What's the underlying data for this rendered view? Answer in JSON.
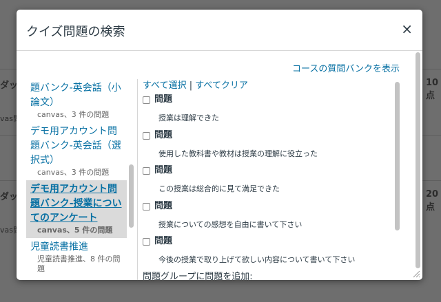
{
  "background": {
    "rows": [
      {
        "left_text": "ダッ",
        "right_text": "10 点"
      },
      {
        "left_text": "vas問",
        "right_text": ""
      },
      {
        "left_text": "ダッ",
        "right_text": "20 点"
      },
      {
        "left_text": "vas問",
        "right_text": ""
      }
    ]
  },
  "dialog": {
    "title": "クイズ問題の検索",
    "close_label": "×",
    "show_course_bank_link": "コースの質問バンクを表示",
    "banks": [
      {
        "name": "題バンク-英会話（小論文）",
        "meta": "canvas、3 件の問題",
        "selected": false
      },
      {
        "name": "デモ用アカウント問題バンク-英会話（選択式）",
        "meta": "canvas、3 件の問題",
        "selected": false
      },
      {
        "name": "デモ用アカウント問題バンク-授業についてのアンケート",
        "meta": "canvas、5 件の問題",
        "selected": true
      },
      {
        "name": "児童読書推進",
        "meta": "児童読書推進、8 件の問題",
        "selected": false
      }
    ],
    "select_all": "すべて選択",
    "separator": "|",
    "clear_all": "すべてクリア",
    "questions": [
      {
        "title": "問題",
        "text": "授業は理解できた"
      },
      {
        "title": "問題",
        "text": "使用した教科書や教材は授業の理解に役立った"
      },
      {
        "title": "問題",
        "text": "この授業は総合的に見て満足できた"
      },
      {
        "title": "問題",
        "text": "授業についての感想を自由に書いて下さい"
      },
      {
        "title": "問題",
        "text": "今後の授業で取り上げて欲しい内容について書いて下さい"
      }
    ],
    "add_to_group_label": "問題グループに問題を追加:"
  },
  "colors": {
    "link": "#0770a3",
    "text": "#2d3b45",
    "selected_bg": "#dadada",
    "overlay": "#6e6e6e"
  }
}
